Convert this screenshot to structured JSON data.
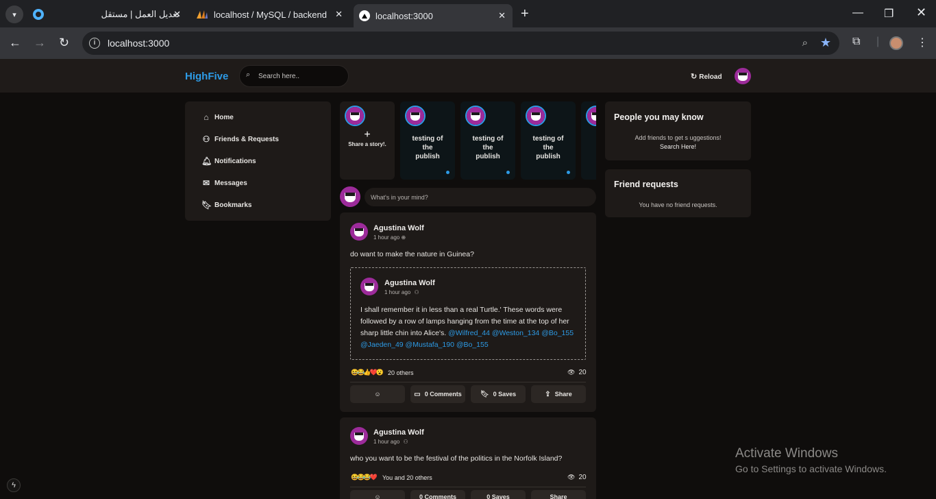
{
  "browser": {
    "tabs": [
      {
        "title": "تعديل العمل | مستقل",
        "favicon": "mostaql-icon"
      },
      {
        "title": "localhost / MySQL / backend / …",
        "favicon": "phpmyadmin-icon"
      },
      {
        "title": "localhost:3000",
        "favicon": "nextjs-icon",
        "active": true
      }
    ],
    "url": "localhost:3000"
  },
  "app": {
    "logo": "HighFive",
    "search_placeholder": "Search here..",
    "reload_label": "Reload"
  },
  "nav": {
    "items": [
      {
        "label": "Home",
        "icon": "home-icon"
      },
      {
        "label": "Friends & Requests",
        "icon": "user-plus-icon"
      },
      {
        "label": "Notifications",
        "icon": "bell-icon"
      },
      {
        "label": "Messages",
        "icon": "mail-icon"
      },
      {
        "label": "Bookmarks",
        "icon": "bookmark-icon"
      }
    ]
  },
  "stories": {
    "create_label": "Share a story!.",
    "items": [
      {
        "text": "testing of the publish"
      },
      {
        "text": "testing of the publish"
      },
      {
        "text": "testing of the publish"
      },
      {
        "text": "t"
      }
    ]
  },
  "composer": {
    "placeholder": "What's in your mind?"
  },
  "posts": [
    {
      "author": "Agustina Wolf",
      "time": "1 hour ago",
      "text": "do want to make the nature in Guinea?",
      "shared": {
        "author": "Agustina Wolf",
        "time": "1 hour ago",
        "text": "I shall remember it in less than a real Turtle.' These words were followed by a row of lamps hanging from the time at the top of her sharp little chin into Alice's.",
        "mentions_line1": "@Wilfred_44 @Weston_134",
        "mentions_line2": "@Bo_155 @Jaeden_49 @Mustafa_190 @Bo_155"
      },
      "reactions": "20 others",
      "views": "20",
      "comments_label": "0 Comments",
      "saves_label": "0 Saves",
      "share_label": "Share"
    },
    {
      "author": "Agustina Wolf",
      "time": "1 hour ago",
      "text": "who you want to be the festival of the politics in the Norfolk Island?",
      "reactions": "You and 20 others",
      "views": "20",
      "comments_label": "0 Comments",
      "saves_label": "0 Saves",
      "share_label": "Share"
    }
  ],
  "sidebar": {
    "people_title": "People you may know",
    "people_text": "Add friends to get s uggestions!",
    "people_link": "Search Here!",
    "requests_title": "Friend requests",
    "requests_text": "You have no friend requests."
  },
  "os": {
    "activate_title": "Activate Windows",
    "activate_sub": "Go to Settings to activate Windows."
  },
  "colors": {
    "accent": "#2d9be6",
    "avatar": "#9c2b9a",
    "card": "#1e1a18"
  }
}
